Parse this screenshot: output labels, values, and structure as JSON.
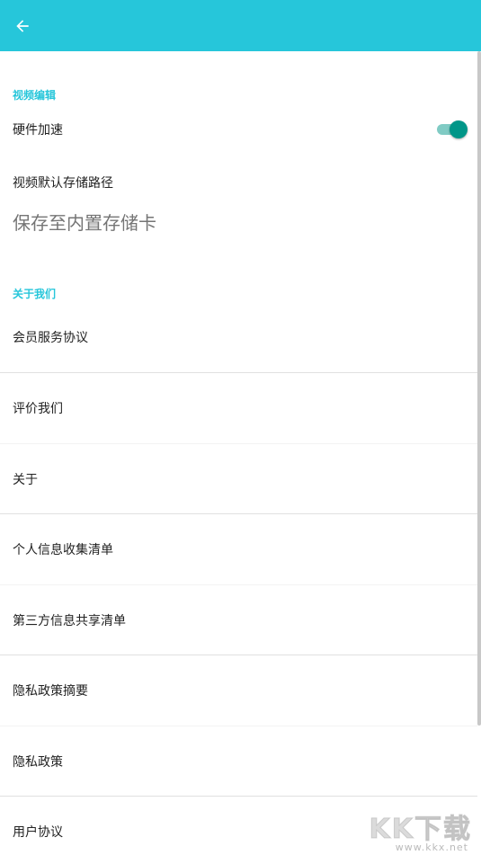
{
  "colors": {
    "accent": "#26c6da",
    "toggle_on": "#009688",
    "toggle_track": "#80cbc4"
  },
  "header": {
    "back_icon": "arrow-left-icon"
  },
  "video_section": {
    "title": "视频编辑",
    "hardware_accel": {
      "label": "硬件加速",
      "enabled": true
    },
    "storage_path": {
      "label": "视频默认存储路径",
      "value": "保存至内置存储卡"
    }
  },
  "about_section": {
    "title": "关于我们",
    "items": [
      {
        "label": "会员服务协议"
      },
      {
        "label": "评价我们"
      },
      {
        "label": "关于"
      },
      {
        "label": "个人信息收集清单"
      },
      {
        "label": "第三方信息共享清单"
      },
      {
        "label": "隐私政策摘要"
      },
      {
        "label": "隐私政策"
      },
      {
        "label": "用户协议"
      }
    ]
  },
  "watermark": {
    "logo": "KK下载",
    "url": "www.kkx.net"
  }
}
